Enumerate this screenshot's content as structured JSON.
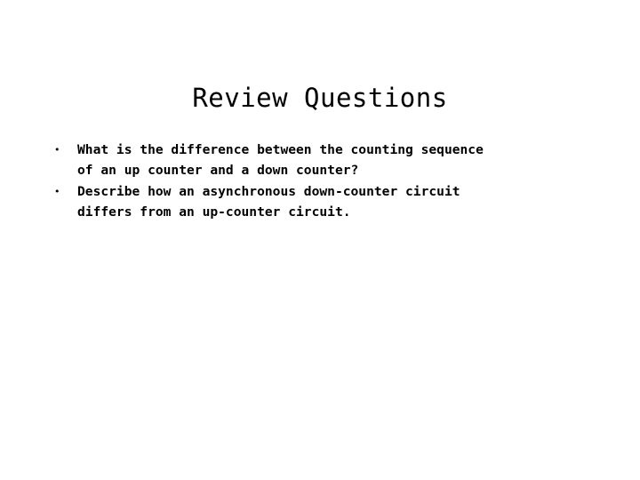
{
  "slide": {
    "title": "Review Questions",
    "background_color": "#ffffff",
    "text_color": "#000000",
    "bullet_glyph": "•",
    "bullets": [
      {
        "lines": [
          "What is the difference between the counting sequence",
          "of an up counter and a down counter?"
        ]
      },
      {
        "lines": [
          "Describe how an asynchronous down-counter circuit",
          "differs from an up-counter circuit."
        ]
      }
    ]
  }
}
